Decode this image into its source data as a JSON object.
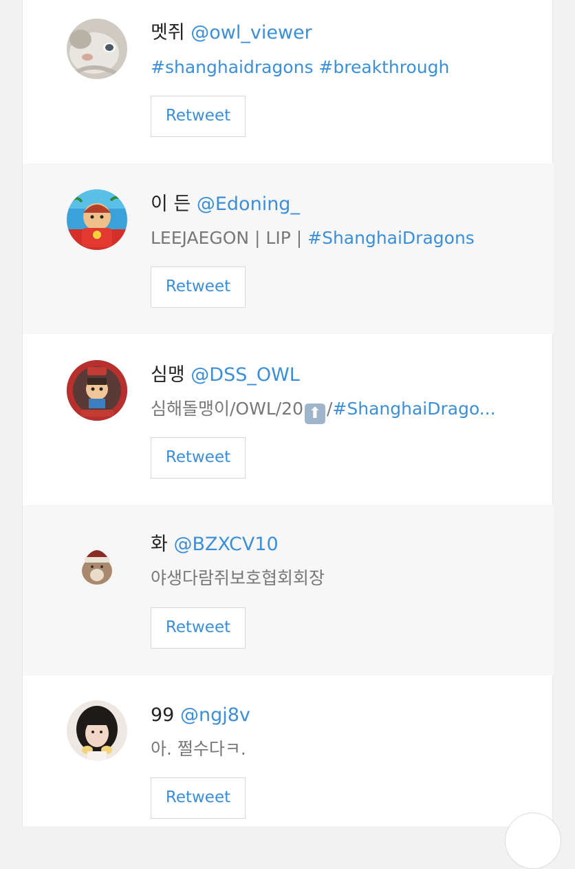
{
  "users": [
    {
      "display_name": "멧쥐",
      "handle": "@owl_viewer",
      "bio_plain": "",
      "bio_tags": "#shanghaidragons #breakthrough",
      "retweet_label": "Retweet",
      "avatar_icon": "cat-face-avatar"
    },
    {
      "display_name": "이 든",
      "handle": "@Edoning_",
      "bio_plain": "LEEJAEGON | LIP | ",
      "bio_tags": "#ShanghaiDragons",
      "retweet_label": "Retweet",
      "avatar_icon": "cartoon-character-avatar"
    },
    {
      "display_name": "심맹",
      "handle": "@DSS_OWL",
      "bio_plain": "심해돌맹이/OWL/20",
      "bio_emoji": "⬆",
      "bio_sep": "/",
      "bio_tags": "#ShanghaiDrago...",
      "retweet_label": "Retweet",
      "avatar_icon": "game-character-avatar"
    },
    {
      "display_name": "화",
      "handle": "@BZXCV10",
      "bio_plain": "야생다람쥐보호협회회장",
      "bio_tags": "",
      "retweet_label": "Retweet",
      "avatar_icon": "hamster-avatar"
    },
    {
      "display_name": "99",
      "handle": "@ngj8v",
      "bio_plain": "아. 쩔수다ㅋ.",
      "bio_tags": "",
      "retweet_label": "Retweet",
      "avatar_icon": "girl-portrait-avatar"
    }
  ],
  "colors": {
    "link": "#3b8fd9",
    "name": "#222222",
    "bio": "#777777",
    "alt_row": "#f7f7f7"
  }
}
